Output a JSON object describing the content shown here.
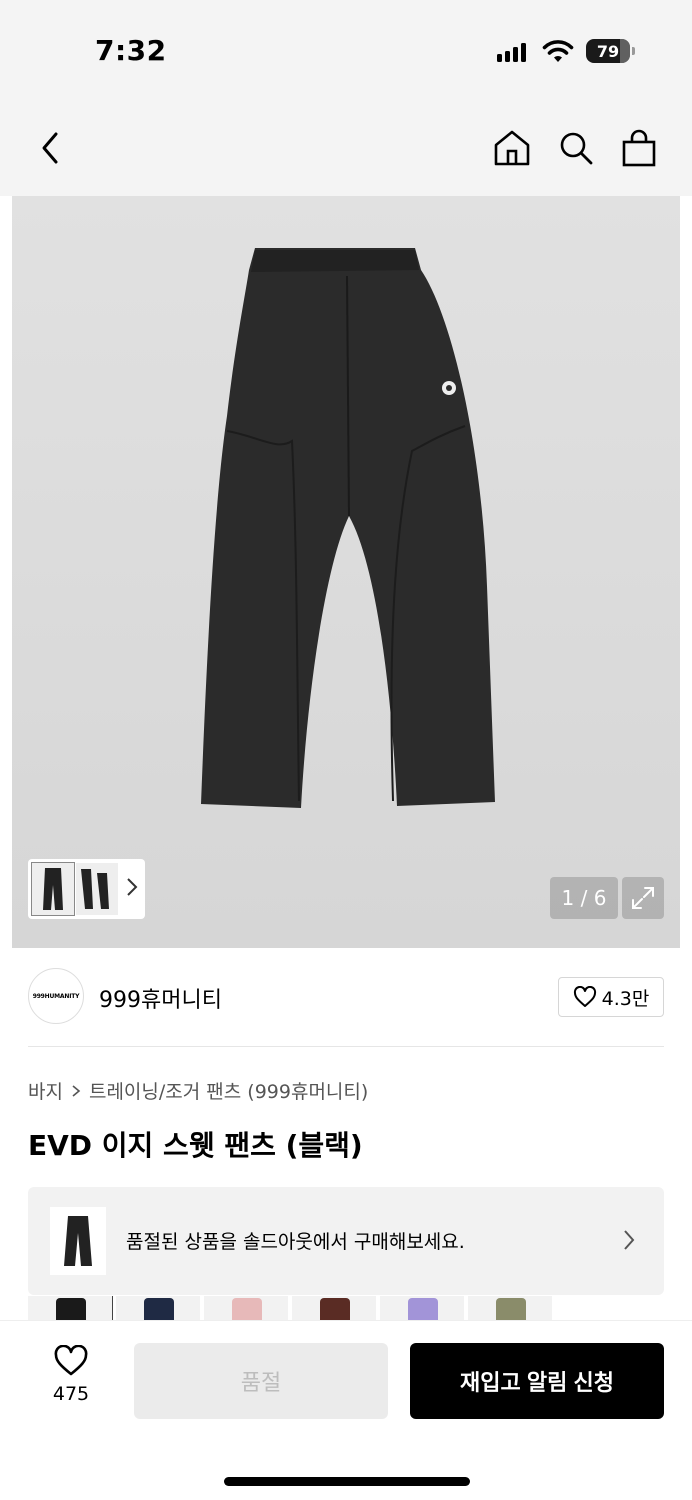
{
  "status_bar": {
    "time": "7:32",
    "battery": "79"
  },
  "gallery": {
    "counter": "1 / 6"
  },
  "brand": {
    "logo_text": "999HUMANITY",
    "name": "999휴머니티",
    "likes": "4.3만"
  },
  "breadcrumb": {
    "category": "바지",
    "subcategory": "트레이닝/조거 팬츠 (999휴머니티)"
  },
  "product": {
    "title": "EVD 이지 스웻 팬츠 (블랙)"
  },
  "soldout_banner": {
    "text": "품절된 상품을 솔드아웃에서 구매해보세요."
  },
  "color_options": {
    "colors": [
      "#1a1a1a",
      "#1f2a44",
      "#e7b9b9",
      "#5a2c24",
      "#a294d8",
      "#8a8c6a"
    ]
  },
  "bottom_bar": {
    "wish_count": "475",
    "soldout_label": "품절",
    "restock_label": "재입고 알림 신청"
  }
}
